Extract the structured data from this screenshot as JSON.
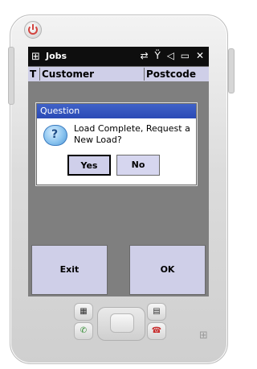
{
  "titlebar": {
    "logo_icon": "windows-start-icon",
    "app_title": "Jobs",
    "status_icons": {
      "connectivity_icon": "connectivity-icon",
      "signal_icon": "no-signal-icon",
      "volume_icon": "volume-icon",
      "battery_icon": "battery-icon",
      "close_icon": "close-icon"
    },
    "status_text": "⇄ 𝚈 ◁ ▭ ✕"
  },
  "table": {
    "columns": [
      "T",
      "Customer",
      "Postcode"
    ]
  },
  "dialog": {
    "title": "Question",
    "message": "Load Complete, Request a New Load?",
    "icon": "question-bubble-icon",
    "yes_label": "Yes",
    "no_label": "No"
  },
  "softkeys": {
    "left_label": "Exit",
    "right_label": "OK"
  },
  "device": {
    "power_icon": "power-icon",
    "left_top_key_icon": "contacts-key-icon",
    "right_top_key_icon": "keyboard-key-icon",
    "call_key_icon": "call-icon",
    "end_key_icon": "end-call-icon",
    "windows_logo_icon": "windows-logo-icon"
  }
}
